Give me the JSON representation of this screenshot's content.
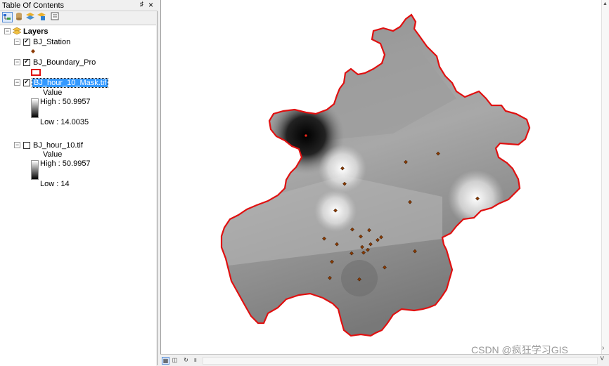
{
  "toc": {
    "title": "Table Of Contents",
    "pin": "♯",
    "close": "×",
    "toolbar": [
      "list-by-drawing-order-icon",
      "list-by-source-icon",
      "list-by-visibility-icon",
      "list-by-selection-icon",
      "options-icon"
    ],
    "layers_label": "Layers",
    "layers": [
      {
        "name": "BJ_Station",
        "checked": true
      },
      {
        "name": "BJ_Boundary_Pro",
        "checked": true
      },
      {
        "name": "BJ_hour_10_Mask.tif",
        "checked": true,
        "selected": true,
        "value_label": "Value",
        "high": "High : 50.9957",
        "low": "Low : 14.0035"
      },
      {
        "name": "BJ_hour_10.tif",
        "checked": false,
        "value_label": "Value",
        "high": "High : 50.9957",
        "low": "Low : 14"
      }
    ]
  },
  "map": {
    "boundary_color": "#e01010",
    "station_color": "#8b3a00",
    "scroll_up": "▲",
    "scroll_right": "›",
    "scroll_down": "˅"
  },
  "status": {
    "buttons": [
      "layout-view-icon",
      "data-view-icon",
      "refresh-icon",
      "pause-icon"
    ]
  },
  "watermark": "CSDN @疯狂学习GIS"
}
